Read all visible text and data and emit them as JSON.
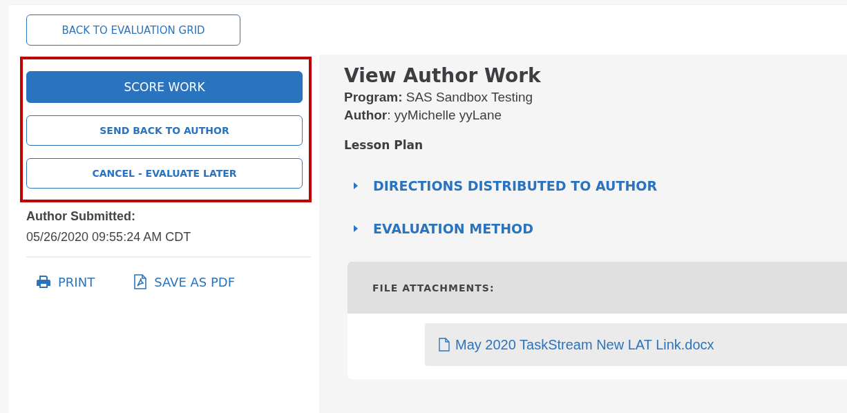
{
  "back_button": "BACK TO EVALUATION GRID",
  "actions": [
    {
      "label": "SCORE WORK",
      "kind": "primary"
    },
    {
      "label": "SEND BACK TO AUTHOR",
      "kind": "secondary"
    },
    {
      "label": "CANCEL - EVALUATE LATER",
      "kind": "secondary"
    }
  ],
  "submitted": {
    "label": "Author Submitted:",
    "value": "05/26/2020 09:55:24 AM CDT"
  },
  "tools": [
    {
      "label": "PRINT",
      "kind": "print"
    },
    {
      "label": "SAVE AS PDF",
      "kind": "pdf"
    }
  ],
  "title": "View Author Work",
  "meta": [
    "**Program:** SAS Sandbox Testing",
    "**Author**: yyMichelle yyLane"
  ],
  "section": "Lesson Plan",
  "accordions": [
    {
      "label": "DIRECTIONS DISTRIBUTED TO AUTHOR",
      "expanded": false
    },
    {
      "label": "EVALUATION METHOD",
      "expanded": false
    }
  ],
  "attachments": {
    "heading": "FILE ATTACHMENTS:",
    "files": [
      "May 2020 TaskStream New LAT Link.docx"
    ]
  }
}
